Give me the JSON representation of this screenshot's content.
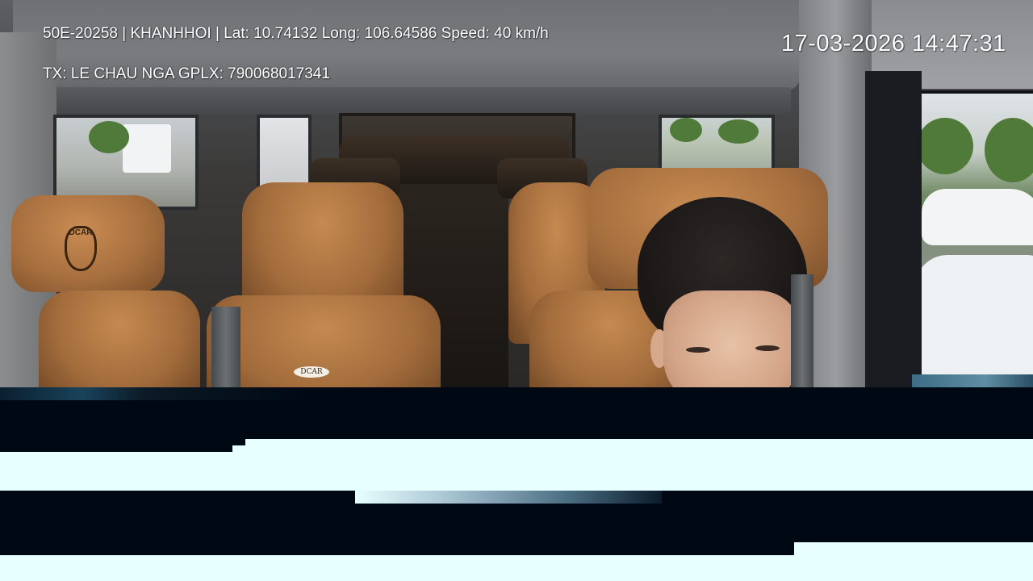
{
  "overlay": {
    "vehicle_line": "50E-20258 | KHANHHOI | Lat: 10.74132 Long: 106.64586 Speed: 40 km/h",
    "driver_line": "TX: LE CHAU NGA GPLX: 790068017341",
    "timestamp": "17-03-2026 14:47:31"
  },
  "seat_branding": {
    "headrest_emblem": "DCAR",
    "seat_badge": "DCAR"
  },
  "colors": {
    "osd_text": "#ffffff",
    "seat_leather": "#b07540",
    "glitch_dark": "#000814",
    "glitch_light": "#e8ffff"
  }
}
